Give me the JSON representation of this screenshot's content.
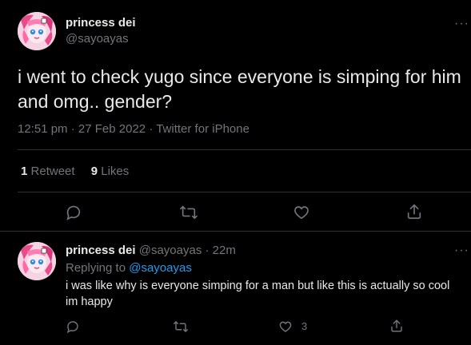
{
  "main_tweet": {
    "display_name": "princess dei",
    "handle": "@sayoayas",
    "more": "···",
    "text_line1": "i went to check yugo since everyone is simping for him",
    "text_line2": "and omg.. gender?",
    "time": "12:51 pm",
    "sep1": "·",
    "date": "27 Feb 2022",
    "sep2": "·",
    "source": "Twitter for iPhone",
    "retweets_count": "1",
    "retweets_label": "Retweet",
    "likes_count": "9",
    "likes_label": "Likes"
  },
  "reply": {
    "display_name": "princess dei",
    "handle": "@sayoayas",
    "sep": "·",
    "time_ago": "22m",
    "more": "···",
    "replying_to_label": "Replying to",
    "replying_to_handle": "@sayoayas",
    "text_line1": "i was like why is everyone simping for a man but like this is actually so cool",
    "text_line2": "im happy",
    "like_count": "3"
  },
  "icons": {
    "reply": "comment-icon",
    "retweet": "retweet-icon",
    "like": "heart-icon",
    "share": "share-icon"
  },
  "colors": {
    "background": "#000000",
    "text": "#e7e9ea",
    "muted": "#71767b",
    "link": "#1d9bf0",
    "divider": "#2f3336"
  }
}
